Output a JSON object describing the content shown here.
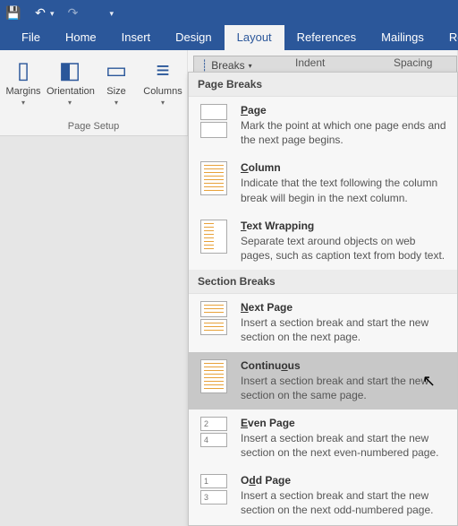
{
  "qat": {
    "save": "💾",
    "undo": "↶",
    "redo": "↷"
  },
  "tabs": {
    "file": "File",
    "home": "Home",
    "insert": "Insert",
    "design": "Design",
    "layout": "Layout",
    "references": "References",
    "mailings": "Mailings",
    "review": "Revie"
  },
  "ribbon": {
    "margins": "Margins",
    "orientation": "Orientation",
    "size": "Size",
    "columns": "Columns",
    "page_setup_label": "Page Setup",
    "breaks_label": "Breaks",
    "indent_label": "Indent",
    "spacing_label": "Spacing"
  },
  "dropdown": {
    "page_breaks_header": "Page Breaks",
    "section_breaks_header": "Section Breaks",
    "items": {
      "page": {
        "title": "Page",
        "desc": "Mark the point at which one page ends and the next page begins."
      },
      "column": {
        "title": "Column",
        "desc": "Indicate that the text following the column break will begin in the next column."
      },
      "text_wrapping": {
        "title": "Text Wrapping",
        "desc": "Separate text around objects on web pages, such as caption text from body text."
      },
      "next_page": {
        "title": "Next Page",
        "desc": "Insert a section break and start the new section on the next page."
      },
      "continuous": {
        "title": "Continuous",
        "desc": "Insert a section break and start the new section on the same page."
      },
      "even_page": {
        "title": "Even Page",
        "desc": "Insert a section break and start the new section on the next even-numbered page."
      },
      "odd_page": {
        "title": "Odd Page",
        "desc": "Insert a section break and start the new section on the next odd-numbered page."
      }
    }
  }
}
